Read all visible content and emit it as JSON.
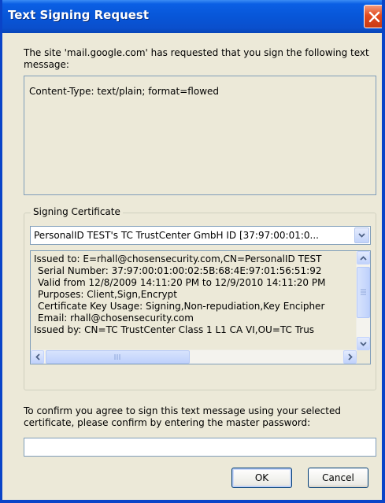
{
  "window": {
    "title": "Text Signing Request"
  },
  "prompt": "The site 'mail.google.com' has requested that you sign the following text message:",
  "message_content": "Content-Type: text/plain; format=flowed",
  "certificate": {
    "group_label": "Signing Certificate",
    "selected": "PersonalID TEST's TC TrustCenter GmbH ID [37:97:00:01:0...",
    "details": [
      "Issued to: E=rhall@chosensecurity.com,CN=PersonalID TEST",
      "Serial Number: 37:97:00:01:00:02:5B:68:4E:97:01:56:51:92",
      "Valid from 12/8/2009 14:11:20 PM to 12/9/2010 14:11:20 PM",
      "Purposes: Client,Sign,Encrypt",
      "Certificate Key Usage: Signing,Non-repudiation,Key Encipher",
      "Email: rhall@chosensecurity.com",
      "Issued by: CN=TC TrustCenter Class 1 L1 CA VI,OU=TC Trus"
    ]
  },
  "confirm_text": "To confirm you agree to sign this text message using your selected certificate, please confirm by entering the master password:",
  "password_value": "",
  "buttons": {
    "ok": "OK",
    "cancel": "Cancel"
  },
  "icons": {
    "close": "close-icon",
    "dropdown": "chevron-down-icon"
  },
  "colors": {
    "titlebar": "#0a5fe4",
    "close_button": "#e24b1f",
    "dialog_bg": "#ece9d8"
  }
}
